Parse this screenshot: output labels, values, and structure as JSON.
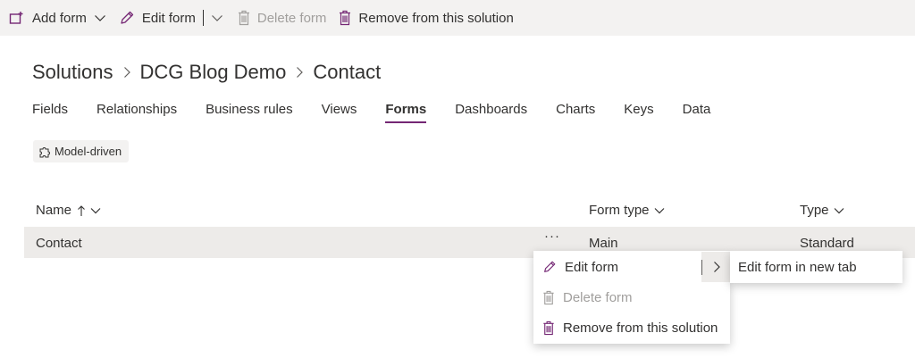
{
  "colors": {
    "accent": "#742774",
    "commandbar_bg": "#f3f2f1",
    "row_selected_bg": "#edebe9",
    "disabled_text": "#a19f9d"
  },
  "commandbar": {
    "add_form": {
      "label": "Add form",
      "icon": "add-form-icon"
    },
    "edit_form": {
      "label": "Edit form",
      "icon": "pencil-icon"
    },
    "delete_form": {
      "label": "Delete form",
      "icon": "trash-icon"
    },
    "remove": {
      "label": "Remove from this solution",
      "icon": "trash-icon"
    }
  },
  "breadcrumb": [
    "Solutions",
    "DCG Blog Demo",
    "Contact"
  ],
  "tabs": [
    "Fields",
    "Relationships",
    "Business rules",
    "Views",
    "Forms",
    "Dashboards",
    "Charts",
    "Keys",
    "Data"
  ],
  "active_tab": "Forms",
  "chip": {
    "label": "Model-driven",
    "icon": "puzzle-icon"
  },
  "table": {
    "columns": {
      "name": "Name",
      "form_type": "Form type",
      "type": "Type"
    },
    "rows": [
      {
        "name": "Contact",
        "form_type": "Main",
        "type": "Standard"
      }
    ],
    "more_label": "···"
  },
  "context_menu": {
    "items": [
      {
        "label": "Edit form",
        "icon": "pencil-icon",
        "disabled": false
      },
      {
        "label": "Delete form",
        "icon": "trash-icon",
        "disabled": true
      },
      {
        "label": "Remove from this solution",
        "icon": "trash-icon",
        "disabled": false
      }
    ],
    "submenu": {
      "label": "Edit form in new tab"
    }
  }
}
